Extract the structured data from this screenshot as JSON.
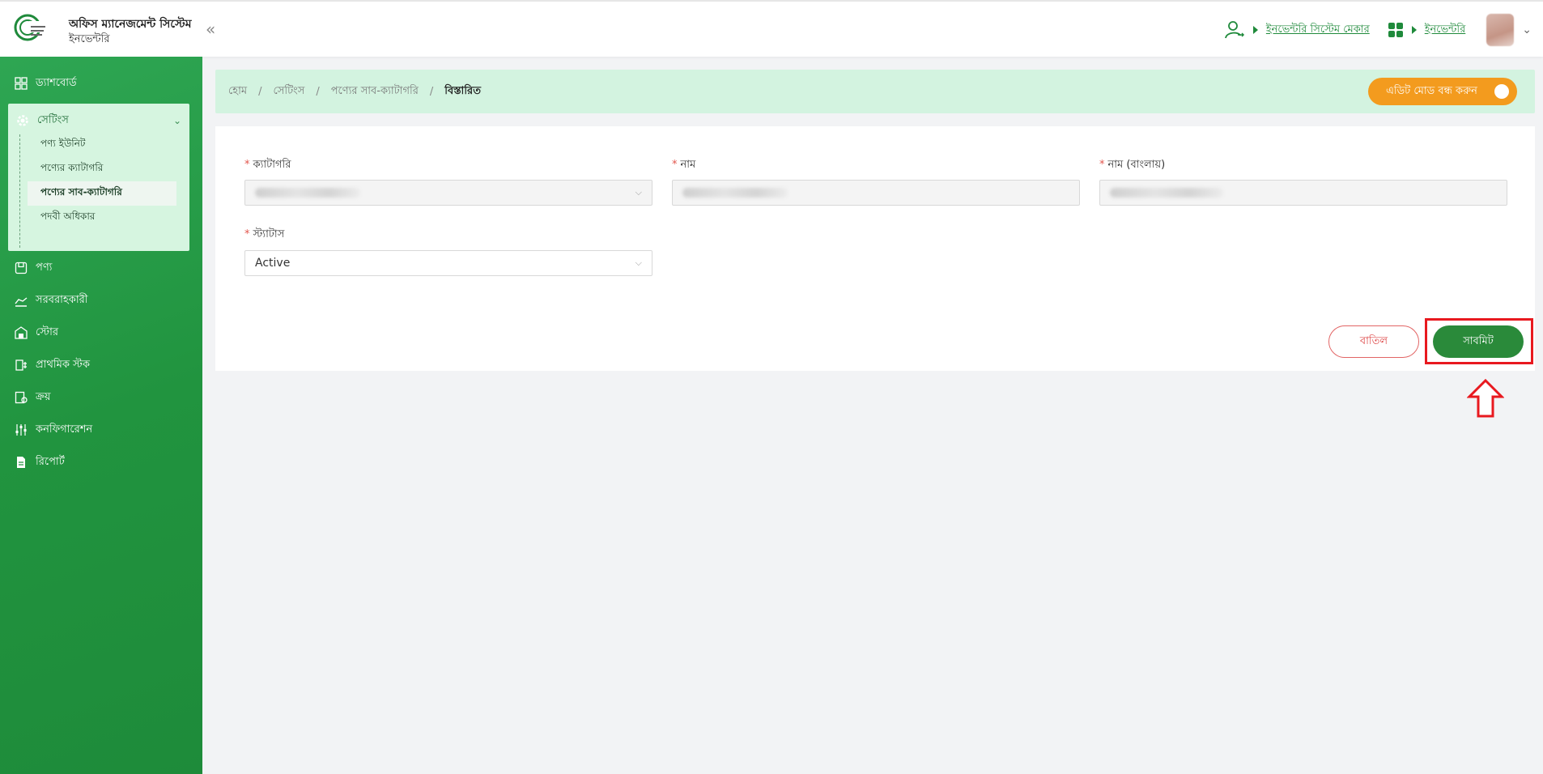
{
  "header": {
    "title": "অফিস ম্যানেজমেন্ট সিস্টেম",
    "subtitle": "ইনভেন্টরি",
    "collapse_icon": "double-chevron-left-icon",
    "role_link": "ইনভেন্টরি সিস্টেম মেকার",
    "module_link": "ইনভেন্টরি"
  },
  "sidebar": {
    "items": [
      {
        "label": "ড্যাশবোর্ড",
        "icon": "dashboard-grid-icon"
      },
      {
        "label": "সেটিংস",
        "icon": "gear-icon"
      },
      {
        "label": "পণ্য",
        "icon": "box-icon"
      },
      {
        "label": "সরবরাহকারী",
        "icon": "supplier-icon"
      },
      {
        "label": "স্টোর",
        "icon": "store-icon"
      },
      {
        "label": "প্রাথমিক স্টক",
        "icon": "stock-icon"
      },
      {
        "label": "ক্রয়",
        "icon": "purchase-icon"
      },
      {
        "label": "কনফিগারেশন",
        "icon": "sliders-icon"
      },
      {
        "label": "রিপোর্ট",
        "icon": "report-icon"
      }
    ],
    "settings_sub": [
      {
        "label": "পণ্য ইউনিট"
      },
      {
        "label": "পণ্যের ক্যাটাগরি"
      },
      {
        "label": "পণ্যের সাব-ক্যাটাগরি"
      },
      {
        "label": "পদবী অধিকার"
      }
    ]
  },
  "breadcrumb": {
    "home": "হোম",
    "settings": "সেটিংস",
    "subcategory": "পণ্যের সাব-ক্যাটাগরি",
    "current": "বিস্তারিত"
  },
  "edit_toggle": {
    "label": "এডিট মোড বন্ধ করুন"
  },
  "form": {
    "required_mark": "*",
    "category_label": "ক্যাটাগরি",
    "name_label": "নাম",
    "name_bn_label": "নাম (বাংলায়)",
    "status_label": "স্ট্যাটাস",
    "status_value": "Active"
  },
  "actions": {
    "cancel": "বাতিল",
    "submit": "সাবমিট"
  },
  "colors": {
    "sidebar": "#21943f",
    "accent_orange": "#f39b1e",
    "submit_green": "#2a8a3a",
    "highlight_red": "#e8191f"
  }
}
